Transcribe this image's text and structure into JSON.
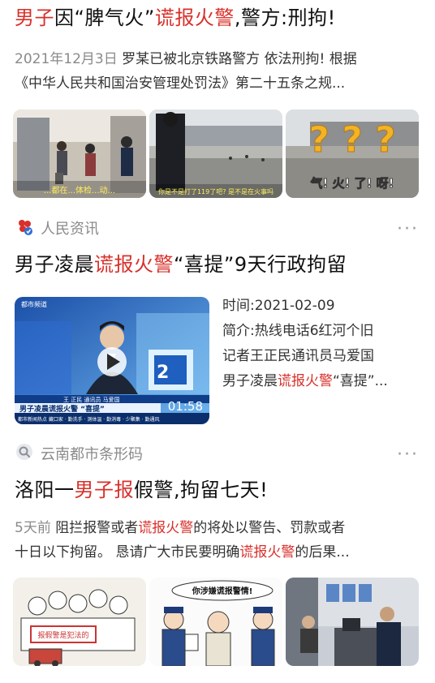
{
  "card1": {
    "title_parts": [
      "男子",
      "因“脾气火”",
      "谎报火警",
      ",警方:刑拘!"
    ],
    "date": "2021年12月3日",
    "line1": " 罗某已被北京铁路警方 依法刑拘! 根据",
    "line2": "《中华人民共和国治安管理处罚法》第二十五条之规...",
    "thumb1_caption": "...都在...体检...动...",
    "thumb2_caption": "你是不是打了119了吧? 是不是在火事吗",
    "thumb3_caption": "气! 火! 了! 呀!",
    "thumb3_marks": "? ? ?"
  },
  "card2": {
    "source": "人民资讯",
    "more": "···",
    "title_parts": [
      "男子凌晨",
      "谎报火警",
      "“喜提”9天行政拘留"
    ],
    "video_logo": "都市频道",
    "video_duration": "01:58",
    "video_headline": "男子凌晨谎报火警 “喜提”",
    "video_ticker": "王 正民 通讯员 马爱国",
    "video_bottom": "都市新闻热点  藏口家 · 勤洗手 · 测体温 · 勤消毒 · 少聚集 · 勤通风",
    "video_corner": "2",
    "time_label": "时间:",
    "time_value": "2021-02-09",
    "intro_label": "简介:",
    "intro_line1": "热线电话6红河个旧",
    "intro_line2": "记者王正民通讯员马爱国",
    "intro_line3_parts": [
      "男子凌晨",
      "谎报火警",
      "“喜提”..."
    ]
  },
  "card3": {
    "source": "云南都市条形码",
    "more": "···",
    "title_parts": [
      "洛阳一",
      "男子报",
      "假警,拘留七天!"
    ],
    "age": "5天前",
    "line1_parts": [
      " 阻拦报警或者",
      "谎报火警",
      "的将处以警告、罚款或者"
    ],
    "line2_parts": [
      "十日以下拘留。 恳请广大市民要明确",
      "谎报火警",
      "的后果..."
    ],
    "thumb1_sign": "报假警是犯法的",
    "thumb2_bubble": "你涉嫌谎报警情!"
  },
  "colors": {
    "highlight": "#d8302b",
    "meta": "#8a8a8a",
    "text": "#111111"
  }
}
